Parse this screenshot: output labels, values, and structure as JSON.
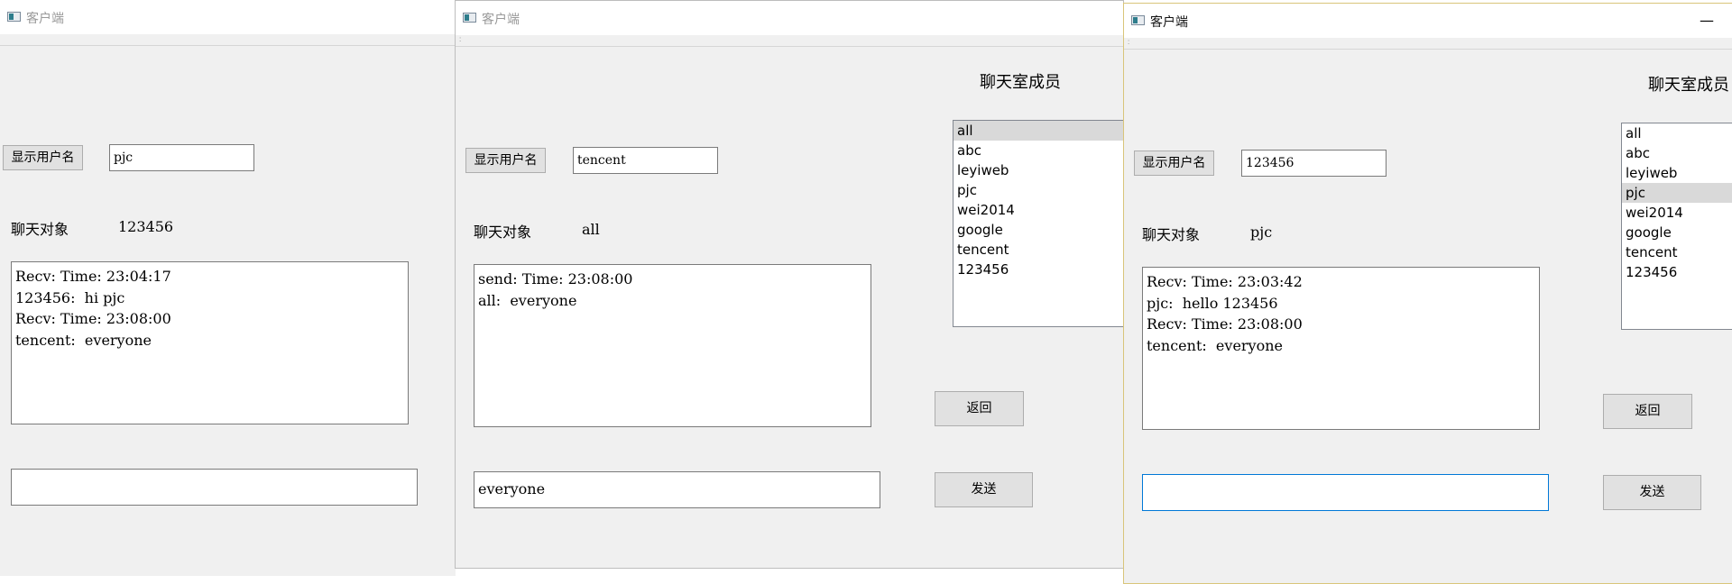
{
  "windows": [
    {
      "title": "客户端",
      "show_user_button": "显示用户名",
      "username_value": "pjc",
      "chat_target_label": "聊天对象",
      "chat_target_value": "123456",
      "messages": [
        "Recv: Time: 23:04:17",
        "123456:  hi pjc",
        "Recv: Time: 23:08:00",
        "tencent:  everyone"
      ],
      "send_input_value": ""
    },
    {
      "title": "客户端",
      "show_user_button": "显示用户名",
      "username_value": "tencent",
      "chat_target_label": "聊天对象",
      "chat_target_value": "all",
      "messages": [
        "send: Time: 23:08:00",
        "all:  everyone"
      ],
      "send_input_value": "everyone",
      "members_title": "聊天室成员",
      "members": [
        "all",
        "abc",
        "leyiweb",
        "pjc",
        "wei2014",
        "google",
        "tencent",
        "123456"
      ],
      "selected_member": "all",
      "back_button": "返回",
      "send_button": "发送"
    },
    {
      "title": "客户端",
      "show_user_button": "显示用户名",
      "username_value": "123456",
      "chat_target_label": "聊天对象",
      "chat_target_value": "pjc",
      "messages": [
        "Recv: Time: 23:03:42",
        "pjc:  hello 123456",
        "Recv: Time: 23:08:00",
        "tencent:  everyone"
      ],
      "send_input_value": "",
      "members_title": "聊天室成员",
      "members": [
        "all",
        "abc",
        "leyiweb",
        "pjc",
        "wei2014",
        "google",
        "tencent",
        "123456"
      ],
      "selected_member": "pjc",
      "back_button": "返回",
      "send_button": "发送",
      "minimize_symbol": "—"
    }
  ],
  "icons": {
    "window": "app-window-icon",
    "minimize": "minimize-icon"
  }
}
